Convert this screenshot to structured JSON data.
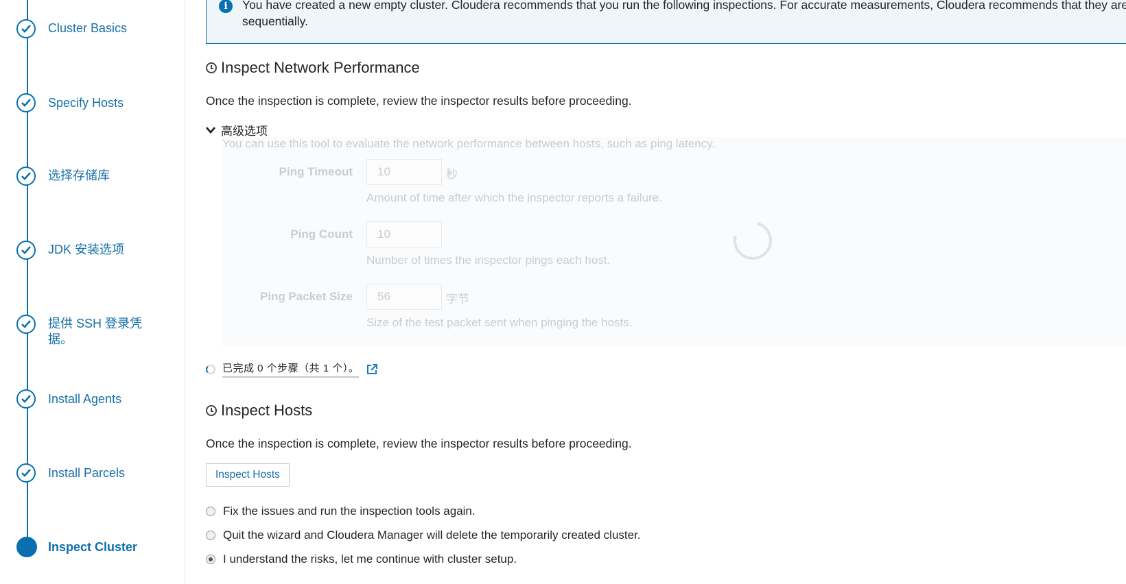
{
  "sidebar": {
    "steps": [
      {
        "label": "Cluster Basics",
        "state": "done"
      },
      {
        "label": "Specify Hosts",
        "state": "done"
      },
      {
        "label": "选择存储库",
        "state": "done"
      },
      {
        "label": "JDK 安装选项",
        "state": "done"
      },
      {
        "label": "提供 SSH 登录凭据。",
        "state": "done"
      },
      {
        "label": "Install Agents",
        "state": "done"
      },
      {
        "label": "Install Parcels",
        "state": "done"
      },
      {
        "label": "Inspect Cluster",
        "state": "current"
      }
    ]
  },
  "info": {
    "line1": "You have created a new empty cluster. Cloudera recommends that you run the following inspections. For accurate measurements, Cloudera recommends that they are",
    "line2": "sequentially."
  },
  "network": {
    "title": "Inspect Network Performance",
    "description": "Once the inspection is complete, review the inspector results before proceeding.",
    "advanced_toggle": "高级选项",
    "advanced_intro": "You can use this tool to evaluate the network performance between hosts, such as ping latency.",
    "fields": {
      "timeout": {
        "label": "Ping Timeout",
        "value": "10",
        "unit": "秒",
        "help": "Amount of time after which the inspector reports a failure."
      },
      "count": {
        "label": "Ping Count",
        "value": "10",
        "unit": "",
        "help": "Number of times the inspector pings each host."
      },
      "packet": {
        "label": "Ping Packet Size",
        "value": "56",
        "unit": "字节",
        "help": "Size of the test packet sent when pinging the hosts."
      }
    },
    "progress_text": "已完成 0 个步骤（共 1 个）。"
  },
  "hosts": {
    "title": "Inspect Hosts",
    "description": "Once the inspection is complete, review the inspector results before proceeding.",
    "button_label": "Inspect Hosts"
  },
  "options": [
    {
      "label": "Fix the issues and run the inspection tools again.",
      "checked": false
    },
    {
      "label": "Quit the wizard and Cloudera Manager will delete the temporarily created cluster.",
      "checked": false
    },
    {
      "label": "I understand the risks, let me continue with cluster setup.",
      "checked": true
    }
  ],
  "colors": {
    "accent": "#0a6fae",
    "link": "#1770a8",
    "info_bg": "#eef6fb"
  }
}
